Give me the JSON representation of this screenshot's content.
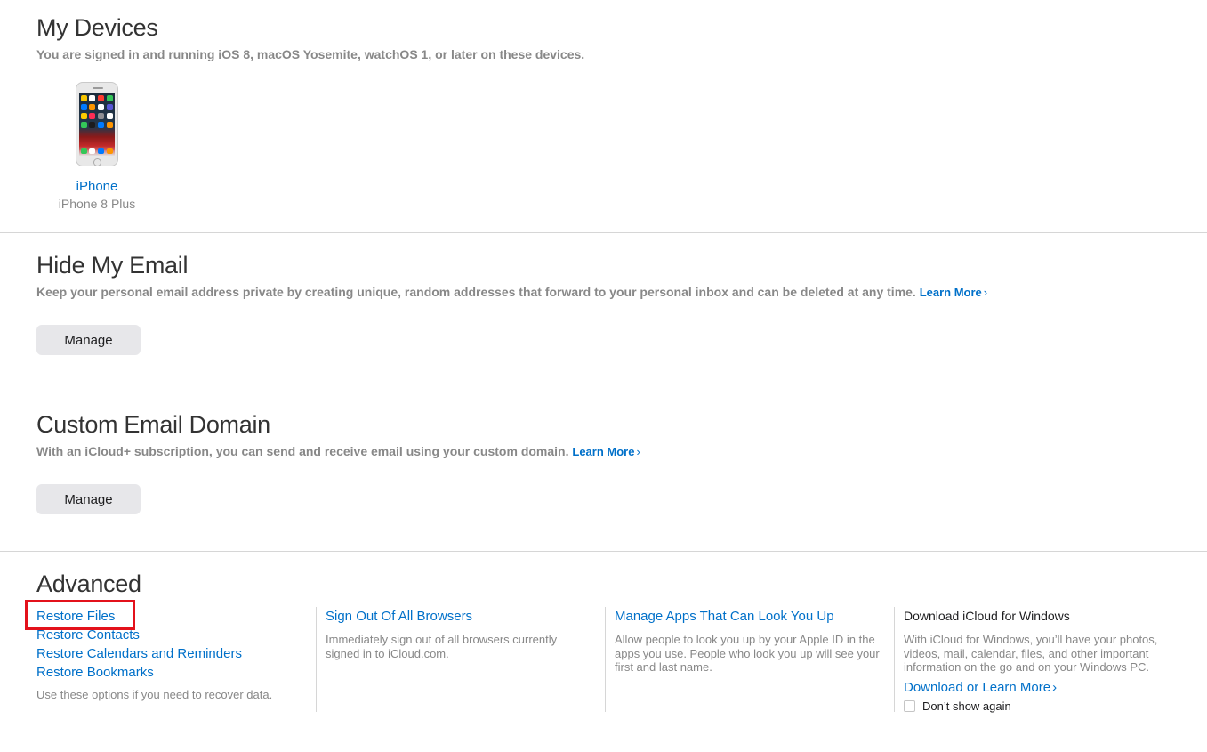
{
  "devices": {
    "title": "My Devices",
    "subtitle": "You are signed in and running iOS 8, macOS Yosemite, watchOS 1, or later on these devices.",
    "items": [
      {
        "name": "iPhone",
        "model": "iPhone 8 Plus",
        "icon": "iphone-icon"
      }
    ]
  },
  "hide_email": {
    "title": "Hide My Email",
    "subtitle": "Keep your personal email address private by creating unique, random addresses that forward to your personal inbox and can be deleted at any time.",
    "learn_more": "Learn More",
    "manage_label": "Manage"
  },
  "custom_domain": {
    "title": "Custom Email Domain",
    "subtitle": "With an iCloud+ subscription, you can send and receive email using your custom domain.",
    "learn_more": "Learn More",
    "manage_label": "Manage"
  },
  "advanced": {
    "title": "Advanced",
    "restore": {
      "links": [
        "Restore Files",
        "Restore Contacts",
        "Restore Calendars and Reminders",
        "Restore Bookmarks"
      ],
      "note": "Use these options if you need to recover data."
    },
    "sign_out": {
      "link": "Sign Out Of All Browsers",
      "desc": "Immediately sign out of all browsers currently signed in to iCloud.com."
    },
    "look_up": {
      "link": "Manage Apps That Can Look You Up",
      "desc": "Allow people to look you up by your Apple ID in the apps you use. People who look you up will see your first and last name."
    },
    "windows": {
      "title": "Download iCloud for Windows",
      "desc": "With iCloud for Windows, you’ll have your photos, videos, mail, calendar, files, and other important information on the go and on your Windows PC.",
      "link": "Download or Learn More",
      "checkbox_label": "Don’t show again",
      "checkbox_checked": false
    }
  },
  "colors": {
    "link": "#0070c9",
    "highlight": "#e3111b",
    "button_bg": "#e7e7ea",
    "muted_text": "#888888"
  }
}
